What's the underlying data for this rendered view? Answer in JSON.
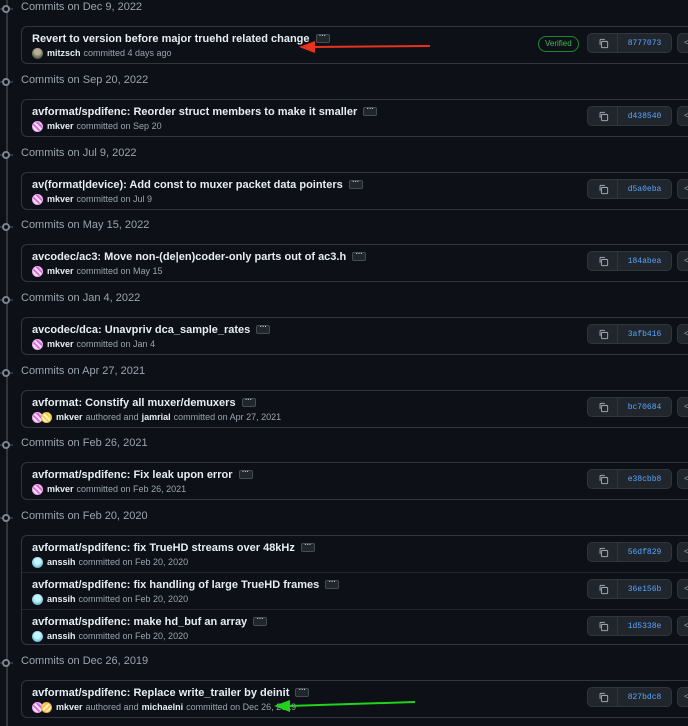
{
  "groups": [
    {
      "title": "Commits on Dec 9, 2022",
      "commits": [
        {
          "message": "Revert to version before major truehd related change",
          "author": "mitzsch",
          "action": "committed 4 days ago",
          "avatar": "mitzsch-avatar",
          "verified": "Verified",
          "sha": "8777073"
        }
      ]
    },
    {
      "title": "Commits on Sep 20, 2022",
      "commits": [
        {
          "message": "avformat/spdifenc: Reorder struct members to make it smaller",
          "author": "mkver",
          "action": "committed on Sep 20",
          "avatar": "mkver-avatar",
          "sha": "d438540"
        }
      ]
    },
    {
      "title": "Commits on Jul 9, 2022",
      "commits": [
        {
          "message": "av(format|device): Add const to muxer packet data pointers",
          "author": "mkver",
          "action": "committed on Jul 9",
          "avatar": "mkver-avatar",
          "sha": "d5a0eba"
        }
      ]
    },
    {
      "title": "Commits on May 15, 2022",
      "commits": [
        {
          "message": "avcodec/ac3: Move non-(de|en)coder-only parts out of ac3.h",
          "author": "mkver",
          "action": "committed on May 15",
          "avatar": "mkver-avatar",
          "sha": "184abea"
        }
      ]
    },
    {
      "title": "Commits on Jan 4, 2022",
      "commits": [
        {
          "message": "avcodec/dca: Unavpriv dca_sample_rates",
          "author": "mkver",
          "action": "committed on Jan 4",
          "avatar": "mkver-avatar",
          "sha": "3afb416"
        }
      ]
    },
    {
      "title": "Commits on Apr 27, 2021",
      "commits": [
        {
          "message": "avformat: Constify all muxer/demuxers",
          "author": "mkver",
          "mid": "authored and",
          "coauthor": "jamrial",
          "action": "committed on Apr 27, 2021",
          "avatar": "mkver-avatar",
          "avatar2": "jamrial-avatar",
          "sha": "bc70684"
        }
      ]
    },
    {
      "title": "Commits on Feb 26, 2021",
      "commits": [
        {
          "message": "avformat/spdifenc: Fix leak upon error",
          "author": "mkver",
          "action": "committed on Feb 26, 2021",
          "avatar": "mkver-avatar",
          "sha": "e38cbb8"
        }
      ]
    },
    {
      "title": "Commits on Feb 20, 2020",
      "commits": [
        {
          "message": "avformat/spdifenc: fix TrueHD streams over 48kHz",
          "author": "anssih",
          "action": "committed on Feb 20, 2020",
          "avatar": "anssih-avatar",
          "sha": "56df829"
        },
        {
          "message": "avformat/spdifenc: fix handling of large TrueHD frames",
          "author": "anssih",
          "action": "committed on Feb 20, 2020",
          "avatar": "anssih-avatar",
          "sha": "36e156b"
        },
        {
          "message": "avformat/spdifenc: make hd_buf an array",
          "author": "anssih",
          "action": "committed on Feb 20, 2020",
          "avatar": "anssih-avatar",
          "sha": "1d5338e"
        }
      ]
    },
    {
      "title": "Commits on Dec 26, 2019",
      "commits": [
        {
          "message": "avformat/spdifenc: Replace write_trailer by deinit",
          "author": "mkver",
          "mid": "authored and",
          "coauthor": "michaelni",
          "action": "committed on Dec 26, 2019",
          "avatar": "mkver-avatar",
          "avatar2": "michaelni-avatar",
          "sha": "827bdc8"
        }
      ]
    }
  ],
  "icons": {
    "copy": "copy-icon",
    "browse": "code-browse-icon",
    "ellipsis": "ellipsis-icon",
    "timeline_dot": "commit-dot-icon"
  },
  "annotations": {
    "red_arrow_color": "#e8321e",
    "green_arrow_color": "#22d11a"
  },
  "colors": {
    "background": "#0d1117",
    "border": "#30363d",
    "sha": "#58a6ff",
    "verified": "#3fb950"
  }
}
